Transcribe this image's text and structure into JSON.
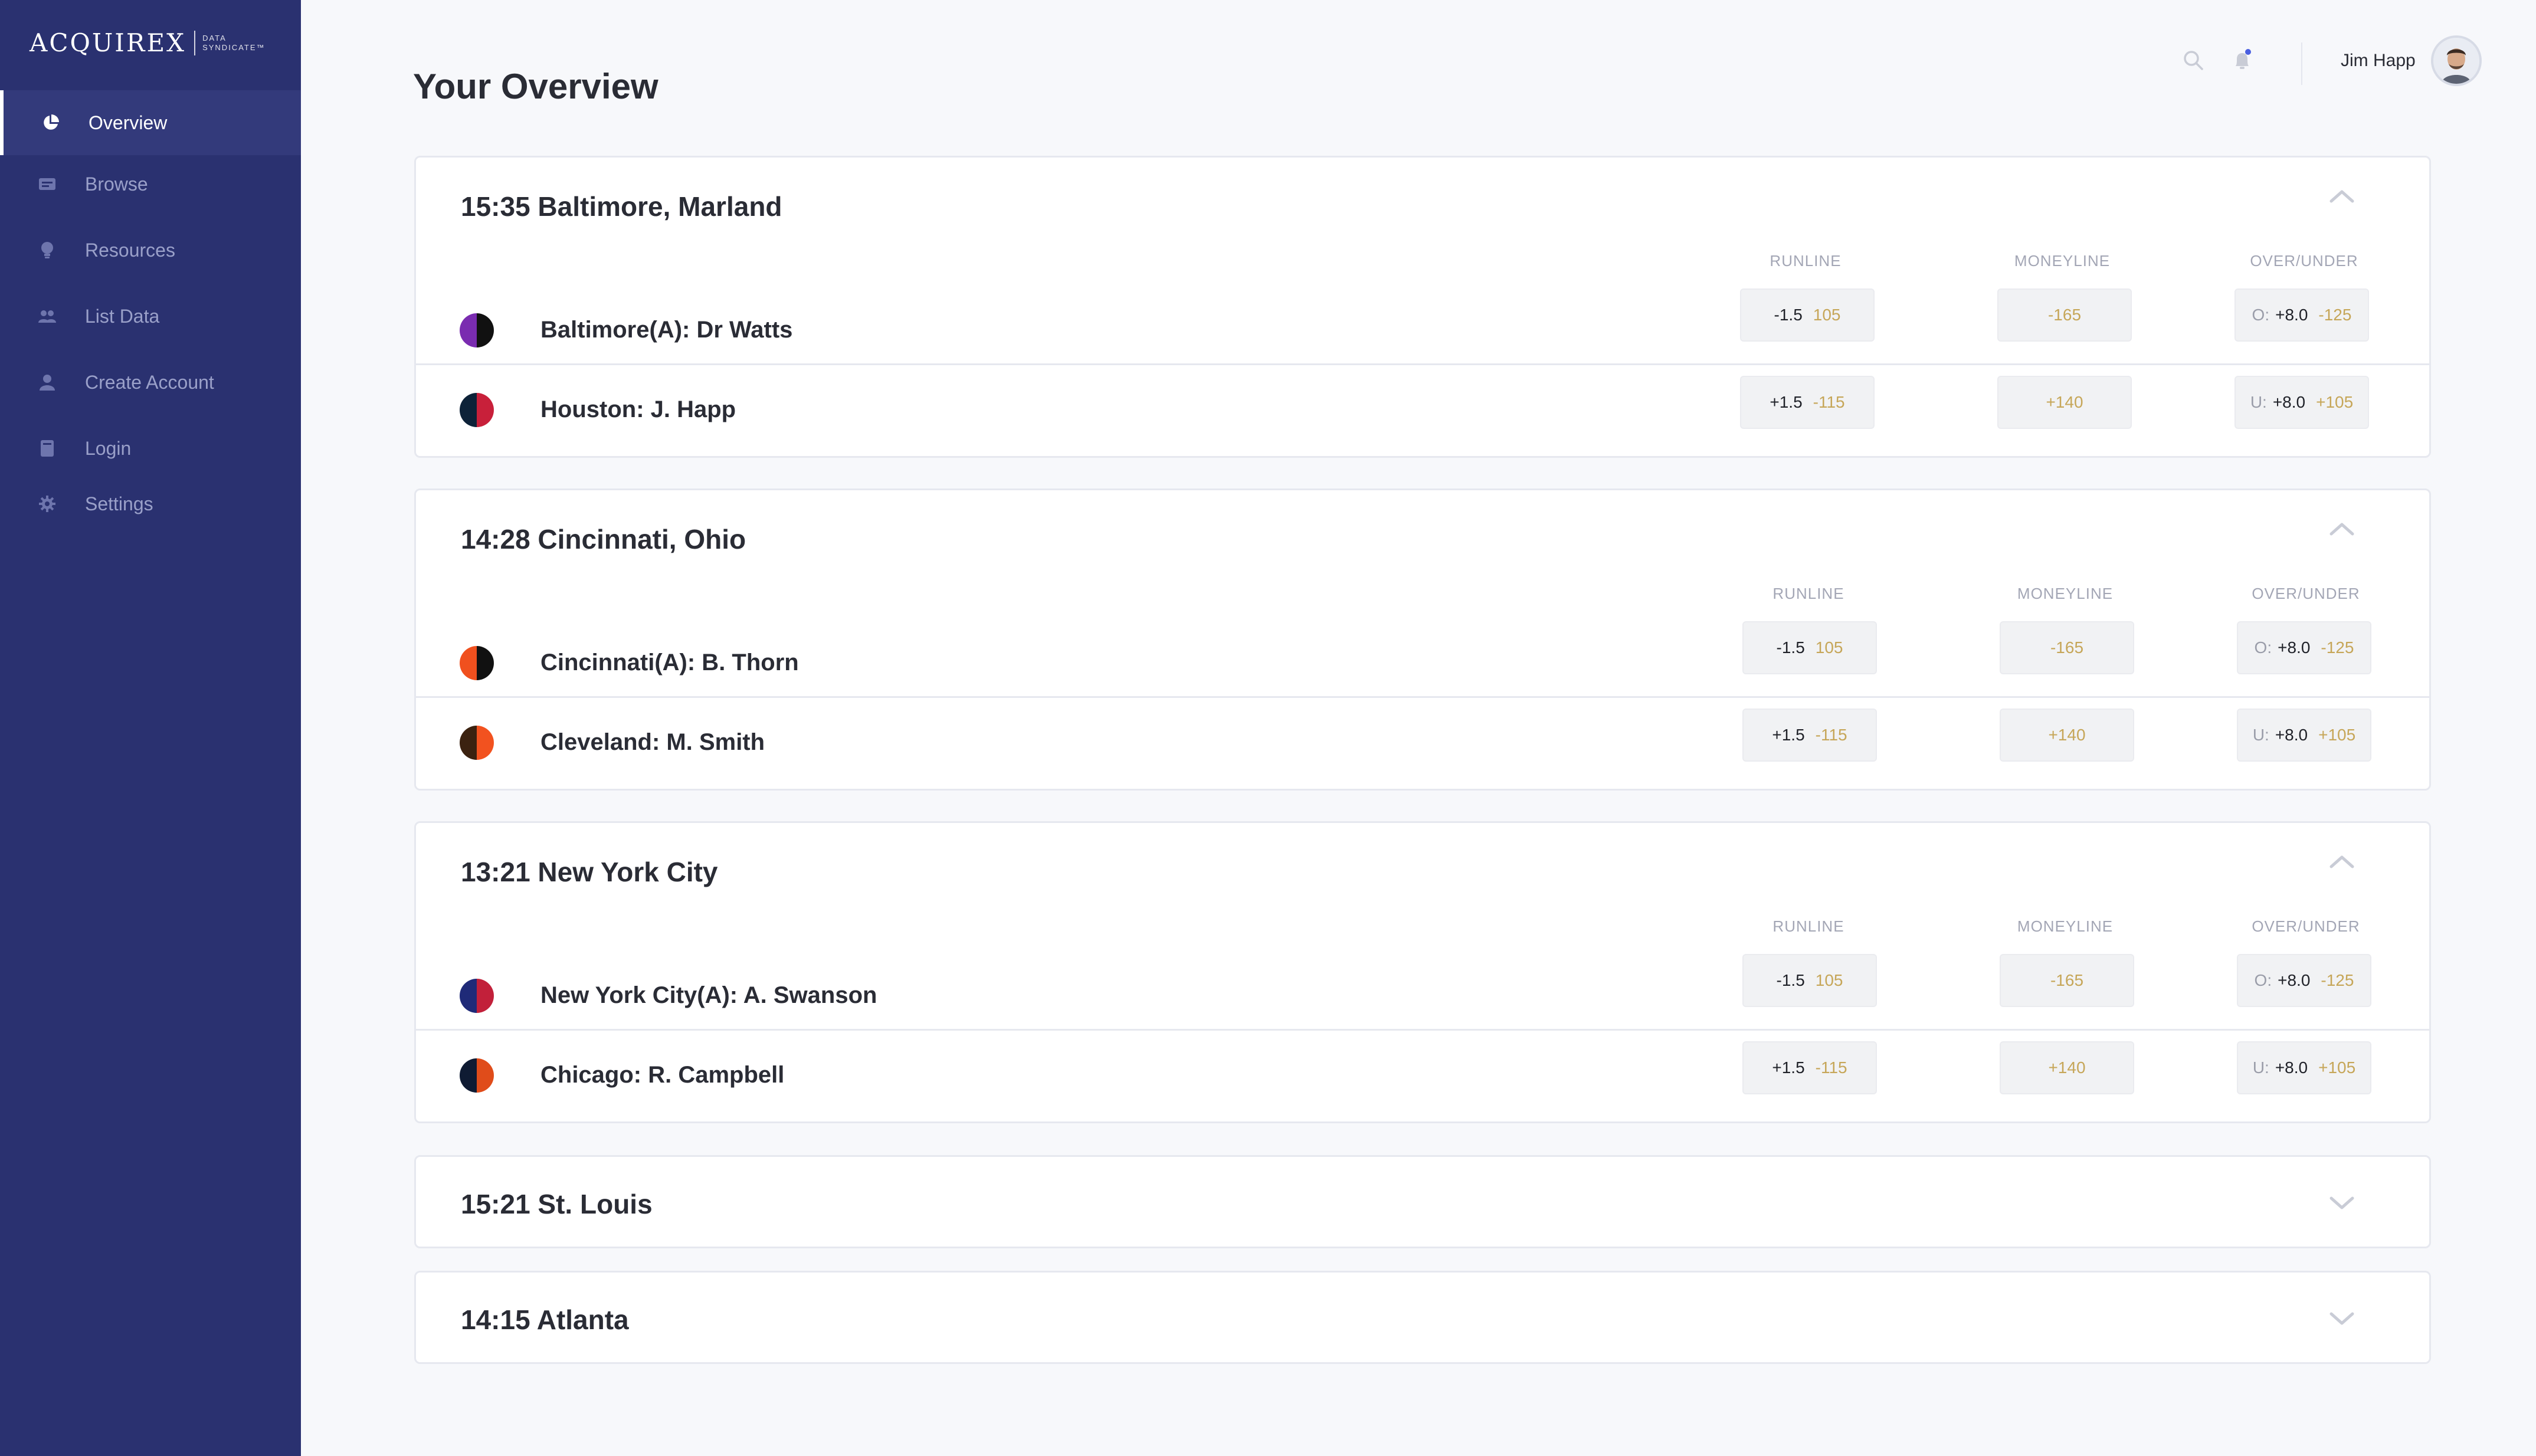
{
  "brand": {
    "name": "ACQUIREX",
    "sub_line1": "DATA",
    "sub_line2": "SYNDICATE™"
  },
  "sidebar": {
    "items": [
      {
        "label": "Overview",
        "icon": "pie-chart-icon",
        "active": true
      },
      {
        "label": "Browse",
        "icon": "browse-icon",
        "active": false
      },
      {
        "label": "Resources",
        "icon": "lightbulb-icon",
        "active": false
      },
      {
        "label": "List Data",
        "icon": "users-icon",
        "active": false
      },
      {
        "label": "Create Account",
        "icon": "user-icon",
        "active": false
      },
      {
        "label": "Login",
        "icon": "book-icon",
        "active": false
      },
      {
        "label": "Settings",
        "icon": "gear-icon",
        "active": false
      }
    ]
  },
  "header": {
    "title": "Your Overview",
    "user_name": "Jim Happ",
    "icons": [
      "search-icon",
      "bell-icon",
      "avatar"
    ]
  },
  "columns": {
    "runline": "RUNLINE",
    "moneyline": "MONEYLINE",
    "over_under": "OVER/UNDER"
  },
  "games": [
    {
      "title": "15:35 Baltimore, Marland",
      "expanded": true,
      "teams": [
        {
          "name": "Baltimore(A): Dr Watts",
          "colors": [
            "#7a2cb0",
            "#111111"
          ],
          "runline": "-1.5",
          "runline_odds": "105",
          "moneyline": "-165",
          "ou_prefix": "O:",
          "ou": "+8.0",
          "ou_odds": "-125"
        },
        {
          "name": "Houston: J. Happ",
          "colors": [
            "#0d2238",
            "#c8203a"
          ],
          "runline": "+1.5",
          "runline_odds": "-115",
          "moneyline": "+140",
          "ou_prefix": "U:",
          "ou": "+8.0",
          "ou_odds": "+105"
        }
      ]
    },
    {
      "title": "14:28 Cincinnati, Ohio",
      "expanded": true,
      "teams": [
        {
          "name": "Cincinnati(A): B. Thorn",
          "colors": [
            "#f0501e",
            "#111111"
          ],
          "runline": "-1.5",
          "runline_odds": "105",
          "moneyline": "-165",
          "ou_prefix": "O:",
          "ou": "+8.0",
          "ou_odds": "-125"
        },
        {
          "name": "Cleveland: M. Smith",
          "colors": [
            "#3b2210",
            "#f2521f"
          ],
          "runline": "+1.5",
          "runline_odds": "-115",
          "moneyline": "+140",
          "ou_prefix": "U:",
          "ou": "+8.0",
          "ou_odds": "+105"
        }
      ]
    },
    {
      "title": "13:21 New York City",
      "expanded": true,
      "teams": [
        {
          "name": "New York City(A): A. Swanson",
          "colors": [
            "#1f2a78",
            "#c2203a"
          ],
          "runline": "-1.5",
          "runline_odds": "105",
          "moneyline": "-165",
          "ou_prefix": "O:",
          "ou": "+8.0",
          "ou_odds": "-125"
        },
        {
          "name": "Chicago: R. Campbell",
          "colors": [
            "#0f1b33",
            "#e04c1a"
          ],
          "runline": "+1.5",
          "runline_odds": "-115",
          "moneyline": "+140",
          "ou_prefix": "U:",
          "ou": "+8.0",
          "ou_odds": "+105"
        }
      ]
    },
    {
      "title": "15:21 St. Louis",
      "expanded": false,
      "teams": []
    },
    {
      "title": "14:15 Atlanta",
      "expanded": false,
      "teams": []
    }
  ],
  "colors": {
    "sidebar_bg": "#2a3170",
    "odds_accent": "#c6a658",
    "notification_dot": "#4a5fe0"
  }
}
